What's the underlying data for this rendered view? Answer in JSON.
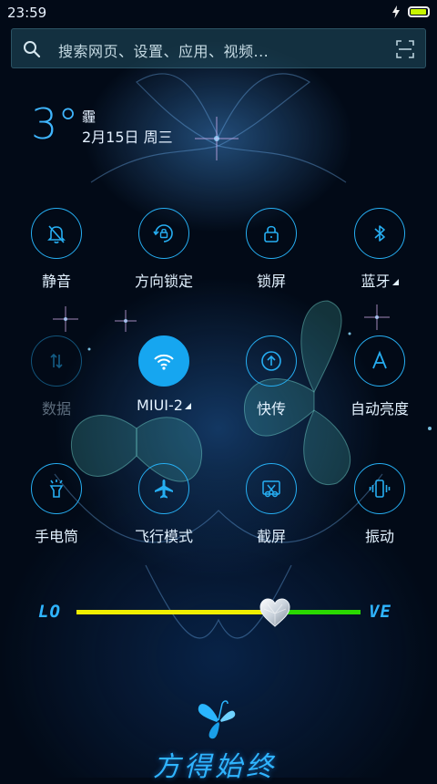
{
  "status_bar": {
    "time": "23:59",
    "battery_level": 0.95
  },
  "search": {
    "placeholder": "搜索网页、设置、应用、视频..."
  },
  "weather": {
    "temperature": "3°",
    "condition": "霾",
    "date": "2月15日 周三"
  },
  "toggles": [
    {
      "key": "mute",
      "label": "静音",
      "icon": "bell-off-icon",
      "state": "off"
    },
    {
      "key": "rotation-lock",
      "label": "方向锁定",
      "icon": "rotation-lock-icon",
      "state": "off"
    },
    {
      "key": "lock-screen",
      "label": "锁屏",
      "icon": "padlock-icon",
      "state": "off"
    },
    {
      "key": "bluetooth",
      "label": "蓝牙",
      "icon": "bluetooth-icon",
      "state": "off",
      "has_menu": true
    },
    {
      "key": "mobile-data",
      "label": "数据",
      "icon": "data-arrows-icon",
      "state": "disabled"
    },
    {
      "key": "wifi",
      "label": "MIUI-2",
      "icon": "wifi-icon",
      "state": "on",
      "has_menu": true
    },
    {
      "key": "quick-transfer",
      "label": "快传",
      "icon": "upload-circle-icon",
      "state": "off"
    },
    {
      "key": "auto-brightness",
      "label": "自动亮度",
      "icon": "letter-a-icon",
      "state": "off"
    },
    {
      "key": "flashlight",
      "label": "手电筒",
      "icon": "flashlight-icon",
      "state": "off"
    },
    {
      "key": "airplane-mode",
      "label": "飞行模式",
      "icon": "airplane-icon",
      "state": "off"
    },
    {
      "key": "screenshot",
      "label": "截屏",
      "icon": "scissors-icon",
      "state": "off"
    },
    {
      "key": "vibrate",
      "label": "振动",
      "icon": "vibrate-icon",
      "state": "off"
    }
  ],
  "brightness": {
    "left_text": "LO",
    "right_text": "VE",
    "level": 0.7,
    "left_color": "#f0ee00",
    "right_color": "#2ad800"
  },
  "footer": {
    "signature": "方得始终"
  },
  "colors": {
    "accent": "#26aef2",
    "background": "#020a17"
  }
}
